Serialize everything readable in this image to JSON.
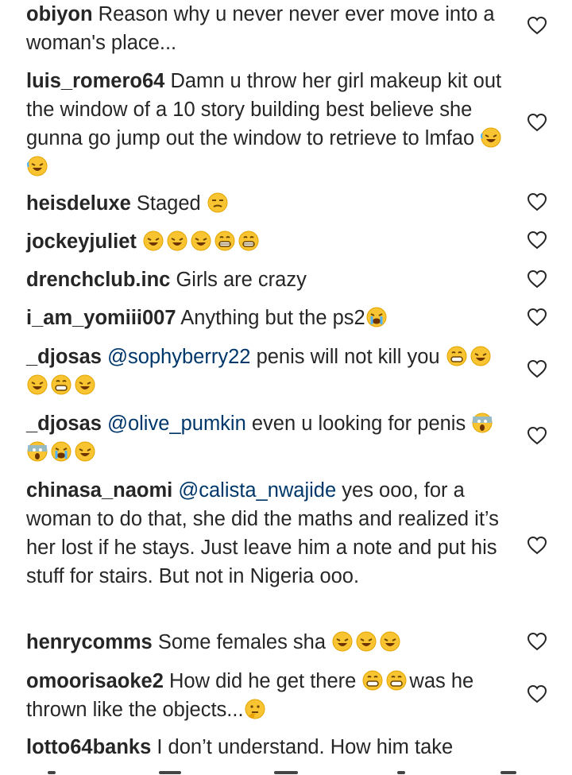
{
  "comments": [
    {
      "username": "obiyon",
      "mention": "",
      "text": "Reason why u never never ever move into a woman's place...",
      "emojis": [],
      "text_after": ""
    },
    {
      "username": "luis_romero64",
      "mention": "",
      "text": "Damn u throw her girl makeup kit out the window of a 10 story building best believe she gunna go jump out the window to retrieve to lmfao",
      "emojis": [
        "rofl",
        "rofl"
      ],
      "text_after": ""
    },
    {
      "username": "heisdeluxe",
      "mention": "",
      "text": "Staged",
      "emojis": [
        "unamused"
      ],
      "text_after": ""
    },
    {
      "username": "jockeyjuliet",
      "mention": "",
      "text": "",
      "emojis": [
        "rofl",
        "rofl",
        "rofl",
        "grin",
        "grin"
      ],
      "text_after": ""
    },
    {
      "username": "drenchclub.inc",
      "mention": "",
      "text": "Girls are crazy",
      "emojis": [],
      "text_after": ""
    },
    {
      "username": "i_am_yomiii007",
      "mention": "",
      "text": "Anything but the ps2",
      "emojis": [
        "crying-loud"
      ],
      "text_after": ""
    },
    {
      "username": "_djosas",
      "mention": "@sophyberry22",
      "text": "penis will not kill you",
      "emojis": [
        "grin",
        "rofl",
        "rofl",
        "grin",
        "rofl"
      ],
      "text_after": ""
    },
    {
      "username": "_djosas",
      "mention": "@olive_pumkin",
      "text": "even u looking for penis",
      "emojis": [
        "scream",
        "scream",
        "crying-loud",
        "rofl"
      ],
      "text_after": ""
    },
    {
      "username": "chinasa_naomi",
      "mention": "@calista_nwajide",
      "text": "yes ooo, for a woman to do that, she did the maths and realized it’s her lost if he stays. Just leave him a note and put his stuff for stairs. But not in Nigeria ooo.",
      "emojis": [],
      "text_after": ""
    },
    {
      "username": "henrycomms",
      "mention": "",
      "text": "Some females sha",
      "emojis": [
        "rofl",
        "rofl",
        "rofl"
      ],
      "text_after": ""
    },
    {
      "username": "omoorisaoke2",
      "mention": "",
      "text": "How did he get there",
      "emojis": [
        "grin",
        "grin"
      ],
      "text_after": "was he thrown like the objects...",
      "emojis_after": [
        "thinking"
      ]
    },
    {
      "username": "lotto64banks",
      "mention": "",
      "text": "I don’t understand. How him take",
      "emojis": [],
      "text_after": ""
    }
  ],
  "colors": {
    "text": "#262626",
    "mention": "#00376b",
    "heart": "#262626",
    "background": "#ffffff"
  },
  "icons": {
    "like": "heart-outline-icon"
  }
}
